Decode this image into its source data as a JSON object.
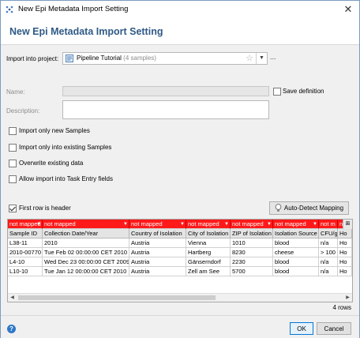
{
  "window": {
    "title": "New Epi Metadata Import Setting"
  },
  "header": {
    "heading": "New Epi Metadata Import Setting"
  },
  "project": {
    "label": "Import into project:",
    "name": "Pipeline Tutorial",
    "samples": "(4 samples)",
    "more": "..."
  },
  "name": {
    "label": "Name:",
    "value": ""
  },
  "save_definition": {
    "label": "Save definition",
    "checked": false
  },
  "description": {
    "label": "Description:",
    "value": ""
  },
  "options": [
    {
      "label": "Import only new Samples",
      "checked": false
    },
    {
      "label": "Import only into existing Samples",
      "checked": false
    },
    {
      "label": "Overwrite existing data",
      "checked": false
    },
    {
      "label": "Allow import into Task Entry fields",
      "checked": false
    }
  ],
  "first_row_header": {
    "label": "First row is header",
    "checked": true
  },
  "auto_detect": {
    "label": "Auto-Detect Mapping"
  },
  "grid": {
    "mapping": [
      "not mapped",
      "not mapped",
      "not mapped",
      "not mapped",
      "not mapped",
      "not mapped",
      "not m",
      "not"
    ],
    "headers": [
      "Sample ID",
      "Collection Date/Year",
      "Country of Isolation",
      "City of Isolation",
      "ZIP of Isolation",
      "Isolation Source",
      "CFU/g",
      "Ho"
    ],
    "rows": [
      [
        "L38-11",
        "2010",
        "Austria",
        "Vienna",
        "1010",
        "blood",
        "n/a",
        "Ho"
      ],
      [
        "2010-00770",
        "Tue Feb 02 00:00:00 CET 2010",
        "Austria",
        "Hartberg",
        "8230",
        "cheese",
        "> 100",
        "Ho"
      ],
      [
        "L4-10",
        "Wed Dec 23 00:00:00 CET 2009",
        "Austria",
        "Gänserndorf",
        "2230",
        "blood",
        "n/a",
        "Ho"
      ],
      [
        "L10-10",
        "Tue Jan 12 00:00:00 CET 2010",
        "Austria",
        "Zell am See",
        "5700",
        "blood",
        "n/a",
        "Ho"
      ]
    ]
  },
  "rows_count": "4 rows",
  "footer": {
    "ok": "OK",
    "cancel": "Cancel",
    "help": "?"
  },
  "colors": {
    "accent": "#2f5a86",
    "unmapped": "#ff1a1a",
    "focus": "#0078d7"
  }
}
